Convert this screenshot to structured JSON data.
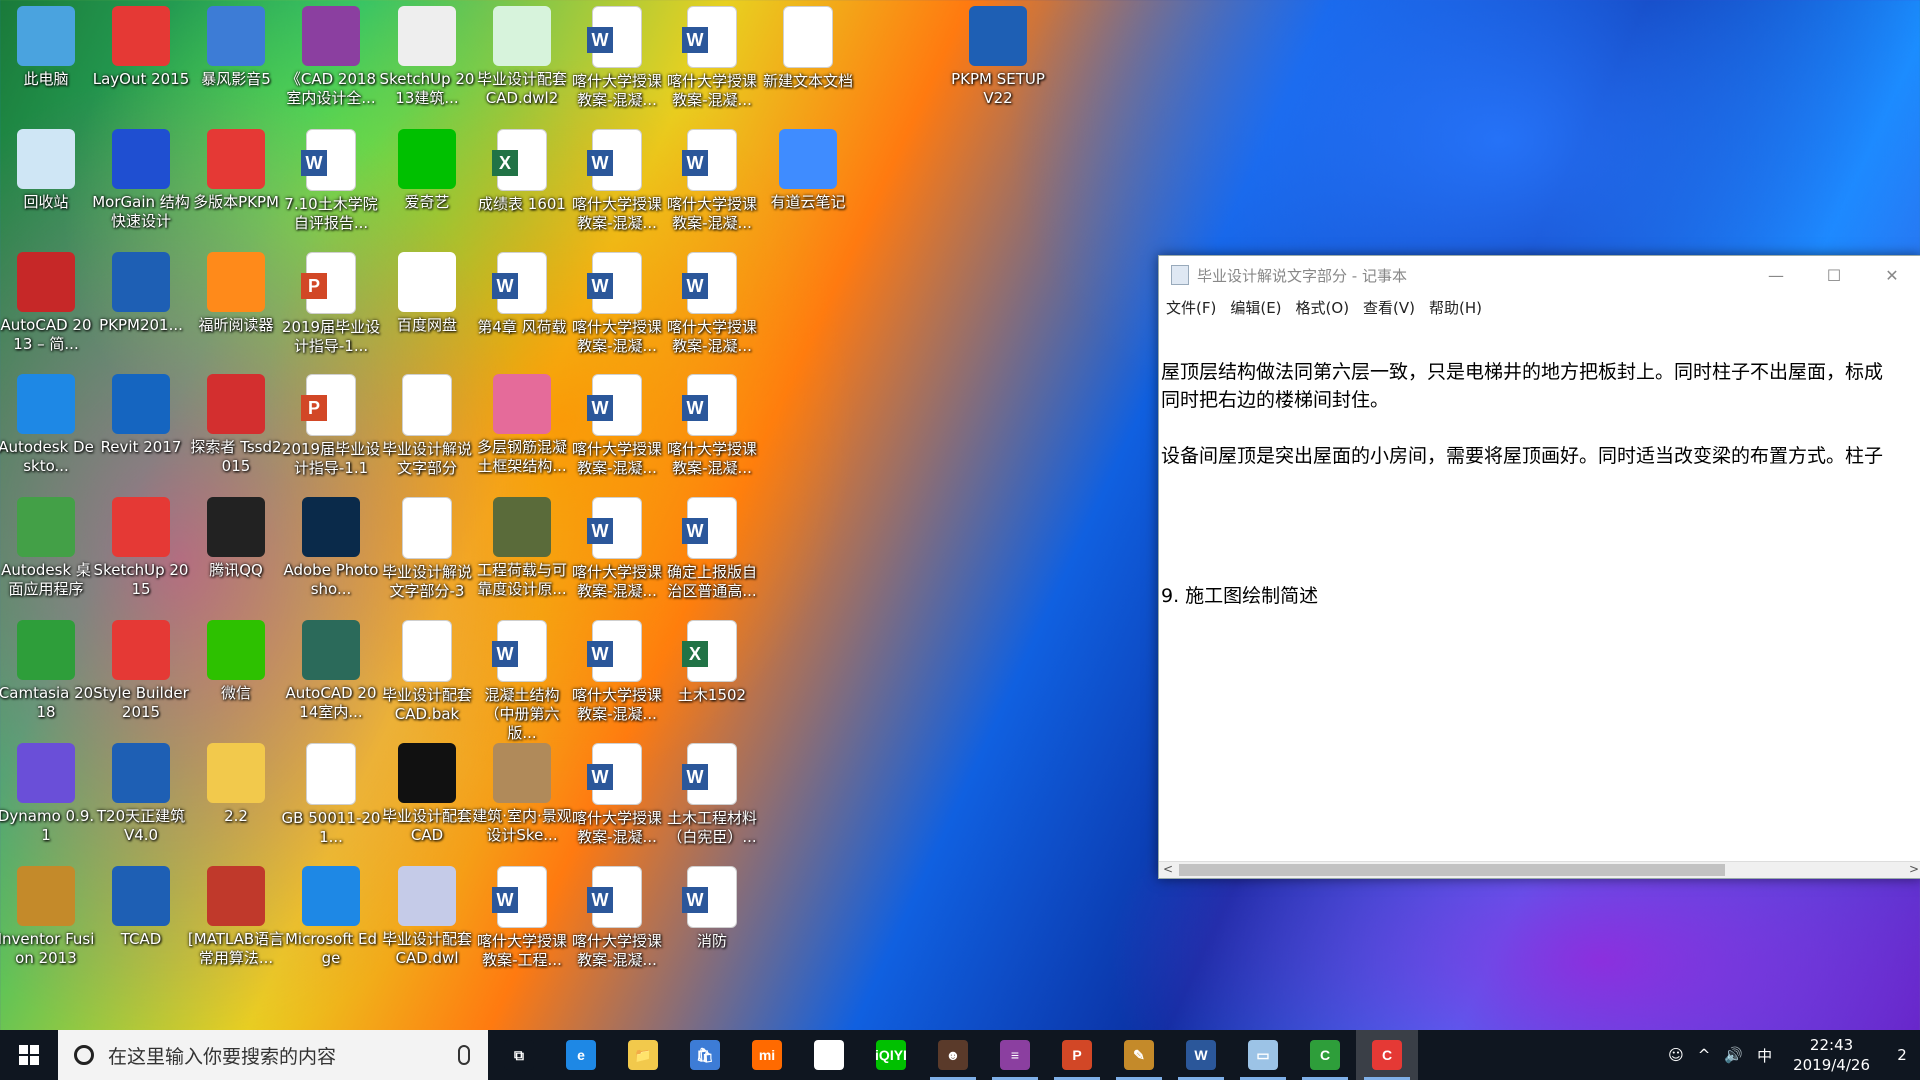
{
  "desktop_icons": [
    {
      "label": "此电脑",
      "kind": "computer-icon",
      "color": "#4aa3df"
    },
    {
      "label": "LayOut 2015",
      "kind": "layout-icon",
      "color": "#e53935"
    },
    {
      "label": "暴风影音5",
      "kind": "storm-player-icon",
      "color": "#3d7cd6"
    },
    {
      "label": "《CAD 2018室内设计全...",
      "kind": "archive-icon",
      "color": "#8b3fa0"
    },
    {
      "label": "SketchUp 2013建筑...",
      "kind": "book-icon",
      "color": "#eeeeee"
    },
    {
      "label": "毕业设计配套CAD.dwl2",
      "kind": "file-icon",
      "color": "#d7f3dc"
    },
    {
      "label": "喀什大学授课教案-混凝...",
      "kind": "word"
    },
    {
      "label": "喀什大学授课教案-混凝...",
      "kind": "word"
    },
    {
      "label": "新建文本文档",
      "kind": "doc"
    },
    {
      "label": "PKPM SETUPV22",
      "kind": "pkpm-setup-icon",
      "color": "#1e5fb4"
    },
    {
      "label": "回收站",
      "kind": "recycle-bin-icon",
      "color": "#cfe6f5"
    },
    {
      "label": "MorGain 结构快速设计",
      "kind": "morgain-icon",
      "color": "#1f4fd1"
    },
    {
      "label": "多版本PKPM",
      "kind": "pkpm-icon",
      "color": "#e53935"
    },
    {
      "label": "7.10土木学院自评报告...",
      "kind": "word"
    },
    {
      "label": "爱奇艺",
      "kind": "iqiyi-icon",
      "color": "#00c000"
    },
    {
      "label": "成绩表 1601",
      "kind": "excel"
    },
    {
      "label": "喀什大学授课教案-混凝...",
      "kind": "word"
    },
    {
      "label": "喀什大学授课教案-混凝...",
      "kind": "word"
    },
    {
      "label": "有道云笔记",
      "kind": "youdao-note-icon",
      "color": "#3f8cff"
    },
    {
      "label": "AutoCAD 2013 – 简...",
      "kind": "autocad-icon",
      "color": "#c62828"
    },
    {
      "label": "PKPM201...",
      "kind": "pkpm-kdm-icon",
      "color": "#1e5fb4"
    },
    {
      "label": "福昕阅读器",
      "kind": "foxit-icon",
      "color": "#ff8a1a"
    },
    {
      "label": "2019届毕业设计指导-1...",
      "kind": "pdf"
    },
    {
      "label": "百度网盘",
      "kind": "baidu-netdisk-icon",
      "color": "#ffffff"
    },
    {
      "label": "第4章 风荷载",
      "kind": "word"
    },
    {
      "label": "喀什大学授课教案-混凝...",
      "kind": "word"
    },
    {
      "label": "喀什大学授课教案-混凝...",
      "kind": "word"
    },
    {
      "label": "Autodesk Deskto...",
      "kind": "autodesk-icon",
      "color": "#1e88e5"
    },
    {
      "label": "Revit 2017",
      "kind": "revit-icon",
      "color": "#1565c0"
    },
    {
      "label": "探索者 Tssd2015",
      "kind": "tssd-icon",
      "color": "#d32f2f"
    },
    {
      "label": "2019届毕业设计指导-1.1",
      "kind": "pdf"
    },
    {
      "label": "毕业设计解说文字部分",
      "kind": "doc"
    },
    {
      "label": "多层钢筋混凝土框架结构...",
      "kind": "book-icon",
      "color": "#e56b9a"
    },
    {
      "label": "喀什大学授课教案-混凝...",
      "kind": "word"
    },
    {
      "label": "喀什大学授课教案-混凝...",
      "kind": "word"
    },
    {
      "label": "Autodesk 桌面应用程序",
      "kind": "autodesk-app-icon",
      "color": "#43a047"
    },
    {
      "label": "SketchUp 2015",
      "kind": "sketchup-icon",
      "color": "#e53935"
    },
    {
      "label": "腾讯QQ",
      "kind": "qq-icon",
      "color": "#222222"
    },
    {
      "label": "Adobe Photosho...",
      "kind": "photoshop-icon",
      "color": "#0a2a4a"
    },
    {
      "label": "毕业设计解说文字部分-3",
      "kind": "doc"
    },
    {
      "label": "工程荷载与可靠度设计原...",
      "kind": "book-icon",
      "color": "#5a6b3a"
    },
    {
      "label": "喀什大学授课教案-混凝...",
      "kind": "word"
    },
    {
      "label": "确定上报版自治区普通高...",
      "kind": "word"
    },
    {
      "label": "Camtasia 2018",
      "kind": "camtasia-icon",
      "color": "#2e9e3a"
    },
    {
      "label": "Style Builder 2015",
      "kind": "style-builder-icon",
      "color": "#e53935"
    },
    {
      "label": "微信",
      "kind": "wechat-icon",
      "color": "#2dc100"
    },
    {
      "label": "AutoCAD 2014室内...",
      "kind": "book-icon",
      "color": "#2b6a5a"
    },
    {
      "label": "毕业设计配套CAD.bak",
      "kind": "doc"
    },
    {
      "label": "混凝土结构（中册第六版...",
      "kind": "word"
    },
    {
      "label": "喀什大学授课教案-混凝...",
      "kind": "word"
    },
    {
      "label": "土木1502",
      "kind": "excel"
    },
    {
      "label": "Dynamo 0.9.1",
      "kind": "dynamo-icon",
      "color": "#6a4fd8"
    },
    {
      "label": "T20天正建筑 V4.0",
      "kind": "t20-icon",
      "color": "#1e5fb4"
    },
    {
      "label": "2.2",
      "kind": "folder-icon",
      "color": "#f2c94c"
    },
    {
      "label": "GB 50011-201...",
      "kind": "doc"
    },
    {
      "label": "毕业设计配套CAD",
      "kind": "cad-file-icon",
      "color": "#111111"
    },
    {
      "label": "建筑·室内·景观设计Ske...",
      "kind": "book-icon",
      "color": "#b08a5a"
    },
    {
      "label": "喀什大学授课教案-混凝...",
      "kind": "word"
    },
    {
      "label": "土木工程材料（白宪臣）...",
      "kind": "word"
    },
    {
      "label": "Inventor Fusion 2013",
      "kind": "inventor-icon",
      "color": "#c48a2a"
    },
    {
      "label": "TCAD",
      "kind": "tcad-icon",
      "color": "#1e5fb4"
    },
    {
      "label": "[MATLAB语言常用算法...",
      "kind": "book-icon",
      "color": "#c0392b"
    },
    {
      "label": "Microsoft Edge",
      "kind": "edge-icon",
      "color": "#1e88e5"
    },
    {
      "label": "毕业设计配套CAD.dwl",
      "kind": "file-icon",
      "color": "#c5cbe8"
    },
    {
      "label": "喀什大学授课教案-工程...",
      "kind": "word"
    },
    {
      "label": "喀什大学授课教案-混凝...",
      "kind": "word"
    },
    {
      "label": "消防",
      "kind": "word"
    }
  ],
  "notepad": {
    "title": "毕业设计解说文字部分 - 记事本",
    "menu": [
      "文件(F)",
      "编辑(E)",
      "格式(O)",
      "查看(V)",
      "帮助(H)"
    ],
    "minimize": "—",
    "maximize": "☐",
    "close": "✕",
    "text": "\n屋顶层结构做法同第六层一致，只是电梯井的地方把板封上。同时柱子不出屋面，标成\n同时把右边的楼梯间封住。\n\n设备间屋顶是突出屋面的小房间，需要将屋顶画好。同时适当改变梁的布置方式。柱子\n\n\n\n\n9. 施工图绘制简述",
    "scroll_left": "<",
    "scroll_right": ">"
  },
  "taskbar": {
    "search_placeholder": "在这里输入你要搜索的内容",
    "apps": [
      {
        "name": "task-view-icon",
        "glyph": "⧉",
        "color": "#0f1620"
      },
      {
        "name": "edge-icon",
        "glyph": "e",
        "color": "#1e88e5"
      },
      {
        "name": "file-explorer-icon",
        "glyph": "📁",
        "color": "#f2c94c"
      },
      {
        "name": "store-icon",
        "glyph": "🛍",
        "color": "#3d7cd6"
      },
      {
        "name": "mi-icon",
        "glyph": "mi",
        "color": "#ff6a00"
      },
      {
        "name": "mail-icon",
        "glyph": "✉",
        "color": "#ffffff"
      },
      {
        "name": "iqiyi-icon",
        "glyph": "iQIYI",
        "color": "#00c000"
      },
      {
        "name": "photo-icon",
        "glyph": "☻",
        "color": "#5a3a2a"
      },
      {
        "name": "winrar-icon",
        "glyph": "≡",
        "color": "#8b3fa0"
      },
      {
        "name": "powerpoint-icon",
        "glyph": "P",
        "color": "#d24726"
      },
      {
        "name": "pen-tool-icon",
        "glyph": "✎",
        "color": "#c48a2a"
      },
      {
        "name": "word-icon",
        "glyph": "W",
        "color": "#2b579a"
      },
      {
        "name": "notepad-icon",
        "glyph": "▭",
        "color": "#9cc3e6"
      },
      {
        "name": "camtasia-icon",
        "glyph": "C",
        "color": "#2e9e3a"
      },
      {
        "name": "camtasia-recorder-icon",
        "glyph": "C",
        "color": "#e53935"
      }
    ],
    "tray": {
      "people": "☺",
      "chevron": "^",
      "volume": "🔊",
      "ime": "中"
    },
    "time": "22:43",
    "date": "2019/4/26",
    "notifications": "2"
  }
}
